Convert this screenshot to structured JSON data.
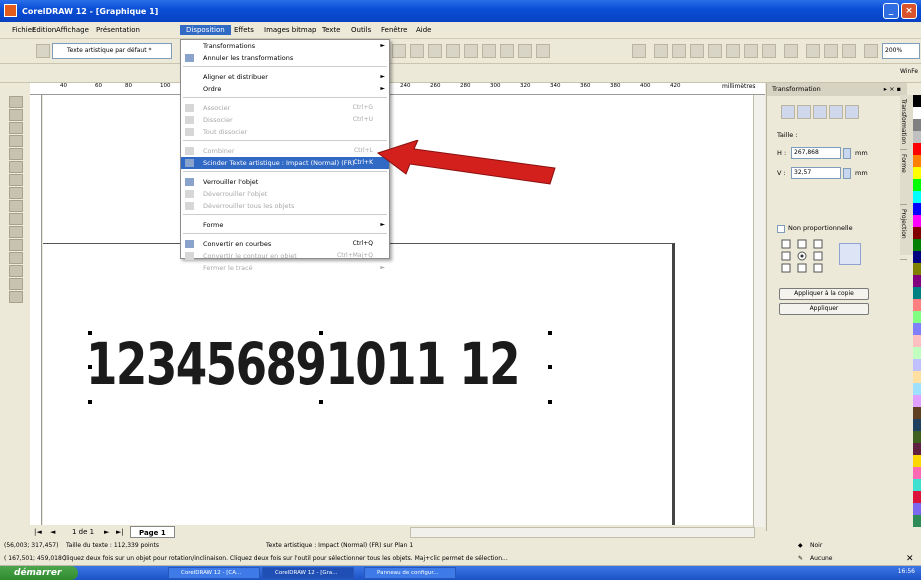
{
  "window": {
    "title": "CorelDRAW 12 - [Graphique 1]",
    "controls": [
      "minimize-icon",
      "restore-icon",
      "close-icon"
    ]
  },
  "menubar": {
    "items": [
      "Fichier",
      "Edition",
      "Affichage",
      "Présentation",
      "Disposition",
      "Effets",
      "Images bitmap",
      "Texte",
      "Outils",
      "Fenêtre",
      "Aide"
    ],
    "active": "Disposition"
  },
  "toolbar": {
    "text_style": "Texte artistique par défaut *",
    "zoom": "200%",
    "extra": "WinFe"
  },
  "ruler": {
    "unit": "millimètres",
    "ticks": [
      "40",
      "60",
      "80",
      "100",
      "240",
      "260",
      "280",
      "300",
      "320",
      "340",
      "360",
      "380",
      "400",
      "420"
    ]
  },
  "dropdown": {
    "items": [
      {
        "label": "Transformations",
        "shortcut": "",
        "submenu": true,
        "disabled": false,
        "icon": ""
      },
      {
        "label": "Annuler les transformations",
        "shortcut": "",
        "submenu": false,
        "disabled": false,
        "icon": "undo-transform-icon"
      },
      {
        "sep": true
      },
      {
        "label": "Aligner et distribuer",
        "shortcut": "",
        "submenu": true,
        "disabled": false,
        "icon": ""
      },
      {
        "label": "Ordre",
        "shortcut": "",
        "submenu": true,
        "disabled": false,
        "icon": ""
      },
      {
        "sep": true
      },
      {
        "label": "Associer",
        "shortcut": "Ctrl+G",
        "submenu": false,
        "disabled": true,
        "icon": "group-icon"
      },
      {
        "label": "Dissocier",
        "shortcut": "Ctrl+U",
        "submenu": false,
        "disabled": true,
        "icon": "ungroup-icon"
      },
      {
        "label": "Tout dissocier",
        "shortcut": "",
        "submenu": false,
        "disabled": true,
        "icon": "ungroup-all-icon"
      },
      {
        "sep": true
      },
      {
        "label": "Combiner",
        "shortcut": "Ctrl+L",
        "submenu": false,
        "disabled": true,
        "icon": "combine-icon"
      },
      {
        "label": "Scinder Texte artistique : Impact (Normal) (FR)",
        "shortcut": "Ctrl+K",
        "submenu": false,
        "disabled": false,
        "icon": "break-apart-icon",
        "highlight": true
      },
      {
        "sep": true
      },
      {
        "label": "Verrouiller l'objet",
        "shortcut": "",
        "submenu": false,
        "disabled": false,
        "icon": "lock-icon"
      },
      {
        "label": "Déverrouiller l'objet",
        "shortcut": "",
        "submenu": false,
        "disabled": true,
        "icon": "unlock-icon"
      },
      {
        "label": "Déverrouiller tous les objets",
        "shortcut": "",
        "submenu": false,
        "disabled": true,
        "icon": "unlock-all-icon"
      },
      {
        "sep": true
      },
      {
        "label": "Forme",
        "shortcut": "",
        "submenu": true,
        "disabled": false,
        "icon": ""
      },
      {
        "sep": true
      },
      {
        "label": "Convertir en courbes",
        "shortcut": "Ctrl+Q",
        "submenu": false,
        "disabled": false,
        "icon": "convert-curves-icon"
      },
      {
        "label": "Convertir le contour en objet",
        "shortcut": "Ctrl+Maj+Q",
        "submenu": false,
        "disabled": true,
        "icon": "outline-object-icon"
      },
      {
        "label": "Fermer le tracé",
        "shortcut": "",
        "submenu": true,
        "disabled": true,
        "icon": ""
      }
    ]
  },
  "canvas": {
    "text": "123456891011 12"
  },
  "docker": {
    "title": "Transformation",
    "size_label": "Taille :",
    "h_label": "H :",
    "h_value": "267,868",
    "h_unit": "mm",
    "v_label": "V :",
    "v_value": "32,57",
    "v_unit": "mm",
    "non_proportional": "Non proportionnelle",
    "apply_copy": "Appliquer à la copie",
    "apply": "Appliquer",
    "side_tabs": [
      "Transformation",
      "Forme",
      "Projection"
    ]
  },
  "pagenav": {
    "counter": "1 de 1",
    "page_tab": "Page 1"
  },
  "status": {
    "coords1": "(56,003; 317,457)",
    "size": "Taille du texte : 112,339 points",
    "object": "Texte artistique : Impact (Normal) (FR) sur Plan 1",
    "coords2": "( 167,501; 459,018 )",
    "hint": "Cliquez deux fois sur un objet pour rotation/inclinaison. Cliquez deux fois sur l'outil pour sélectionner tous les objets. Maj+clic permet de sélection...",
    "fill": "Noir",
    "outline": "Aucune"
  },
  "taskbar": {
    "start": "démarrer",
    "tasks": [
      "CorelDRAW 12 - [CA...",
      "CorelDRAW 12 - [Gra...",
      "Panneau de configur..."
    ],
    "clock": "16:56"
  },
  "palette": [
    "#000000",
    "#ffffff",
    "#808080",
    "#c0c0c0",
    "#ff0000",
    "#ff8000",
    "#ffff00",
    "#00ff00",
    "#00ffff",
    "#0000ff",
    "#ff00ff",
    "#800000",
    "#008000",
    "#000080",
    "#808000",
    "#800080",
    "#008080",
    "#ff8080",
    "#80ff80",
    "#8080ff",
    "#ffc0c0",
    "#c0ffc0",
    "#c0c0ff",
    "#ffe0a0",
    "#a0e0ff",
    "#e0a0ff",
    "#604020",
    "#204060",
    "#406020",
    "#602040",
    "#ffd700",
    "#ff69b4",
    "#40e0d0",
    "#dc143c",
    "#7b68ee",
    "#2e8b57"
  ]
}
